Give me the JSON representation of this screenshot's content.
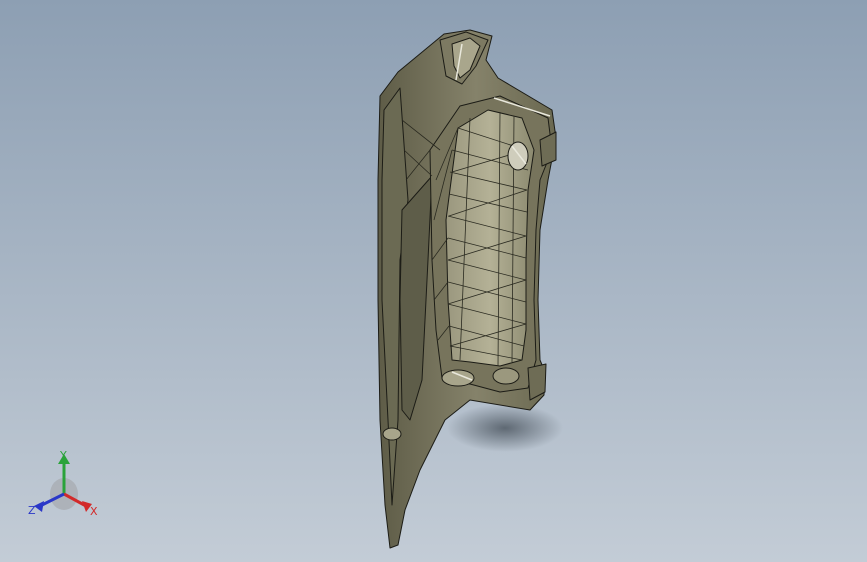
{
  "viewport": {
    "background_top": "#8d9fb3",
    "background_bottom": "#c3ccd6",
    "model": {
      "shade_color": "#6f6d55",
      "face_color": "#8e8b6e",
      "edge_color": "#1c1c16",
      "highlight_color": "#e9e8dc",
      "shadow_color": "#5b6570"
    }
  },
  "triad": {
    "x_label": "X",
    "y_label": "Y",
    "z_label": "Z",
    "x_color": "#d22a2a",
    "y_color": "#2aa33a",
    "z_color": "#2a37c8"
  }
}
